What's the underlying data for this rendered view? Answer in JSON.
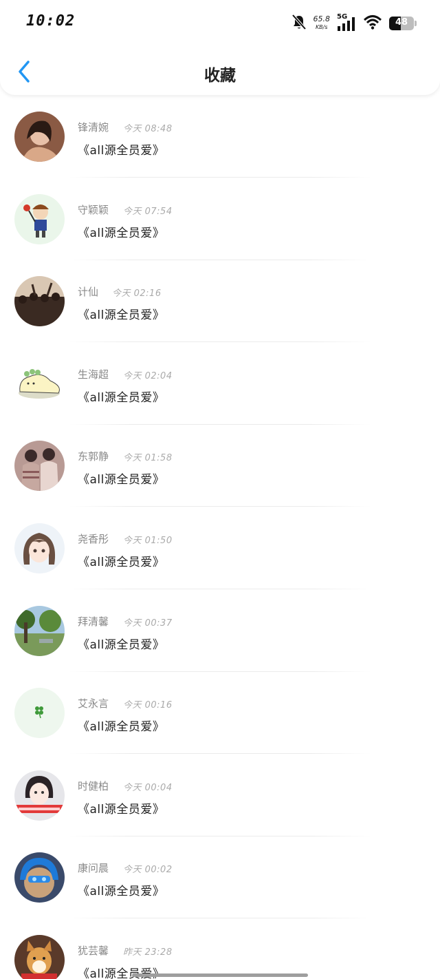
{
  "status_bar": {
    "time": "10:02",
    "net_speed_value": "65.8",
    "net_speed_unit": "KB/s",
    "network_type": "5G",
    "battery_level": "48"
  },
  "header": {
    "title": "收藏"
  },
  "items": [
    {
      "name": "锋清婉",
      "time": "今天 08:48",
      "content": "《all源全员爱》"
    },
    {
      "name": "守颖颖",
      "time": "今天 07:54",
      "content": "《all源全员爱》"
    },
    {
      "name": "计仙",
      "time": "今天 02:16",
      "content": "《all源全员爱》"
    },
    {
      "name": "生海超",
      "time": "今天 02:04",
      "content": "《all源全员爱》"
    },
    {
      "name": "东郭静",
      "time": "今天 01:58",
      "content": "《all源全员爱》"
    },
    {
      "name": "尧香彤",
      "time": "今天 01:50",
      "content": "《all源全员爱》"
    },
    {
      "name": "拜清馨",
      "time": "今天 00:37",
      "content": "《all源全员爱》"
    },
    {
      "name": "艾永言",
      "time": "今天 00:16",
      "content": "《all源全员爱》"
    },
    {
      "name": "时健柏",
      "time": "今天 00:04",
      "content": "《all源全员爱》"
    },
    {
      "name": "康问晨",
      "time": "今天 00:02",
      "content": "《all源全员爱》"
    },
    {
      "name": "犹芸馨",
      "time": "昨天 23:28",
      "content": "《all源全员爱》"
    }
  ],
  "colors": {
    "accent": "#2196f3",
    "name_text": "#8a8a8a",
    "time_text": "#aaaaaa",
    "content_text": "#222222"
  }
}
